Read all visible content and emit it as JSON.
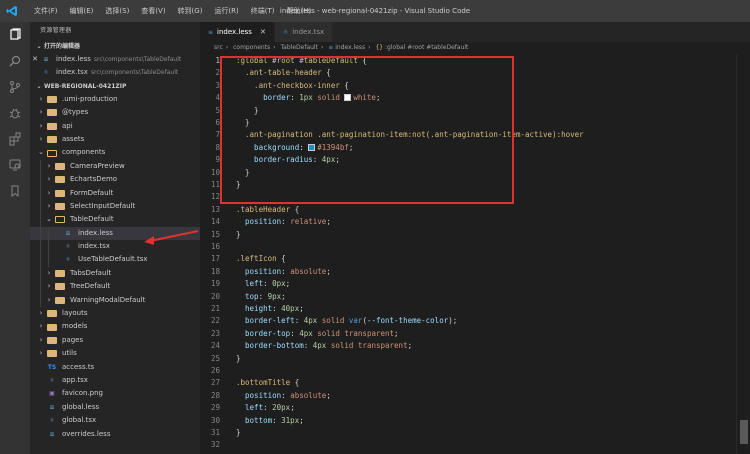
{
  "window": {
    "title": "index.less - web-regional-0421zip - Visual Studio Code",
    "menu": [
      "文件(F)",
      "编辑(E)",
      "选择(S)",
      "查看(V)",
      "转到(G)",
      "运行(R)",
      "终端(T)",
      "帮助(H)"
    ]
  },
  "activity_bar": {
    "icons": [
      "files-icon",
      "search-icon",
      "source-control-icon",
      "debug-icon",
      "extensions-icon",
      "remote-icon",
      "bookmark-icon"
    ]
  },
  "sidebar": {
    "header": "资源管理器",
    "open_editors_title": "打开的编辑器",
    "open_editors": [
      {
        "name": "index.less",
        "path": "src\\components\\TableDefault",
        "type": "less"
      },
      {
        "name": "index.tsx",
        "path": "src\\components\\TableDefault",
        "type": "tsx"
      }
    ],
    "project_title": "WEB-REGIONAL-0421ZIP",
    "tree": [
      {
        "label": ".umi-production",
        "kind": "folder",
        "depth": 1,
        "expanded": false
      },
      {
        "label": "@types",
        "kind": "folder",
        "depth": 1,
        "expanded": false
      },
      {
        "label": "api",
        "kind": "folder",
        "depth": 1,
        "expanded": false
      },
      {
        "label": "assets",
        "kind": "folder",
        "depth": 1,
        "expanded": false
      },
      {
        "label": "components",
        "kind": "folder",
        "depth": 1,
        "expanded": true
      },
      {
        "label": "CameraPreview",
        "kind": "folder",
        "depth": 2,
        "expanded": false
      },
      {
        "label": "EchartsDemo",
        "kind": "folder",
        "depth": 2,
        "expanded": false
      },
      {
        "label": "FormDefault",
        "kind": "folder",
        "depth": 2,
        "expanded": false
      },
      {
        "label": "SelectInputDefault",
        "kind": "folder",
        "depth": 2,
        "expanded": false
      },
      {
        "label": "TableDefault",
        "kind": "folder",
        "depth": 2,
        "expanded": true
      },
      {
        "label": "index.less",
        "kind": "less",
        "depth": 3,
        "selected": true
      },
      {
        "label": "index.tsx",
        "kind": "tsx",
        "depth": 3
      },
      {
        "label": "UseTableDefault.tsx",
        "kind": "tsx",
        "depth": 3
      },
      {
        "label": "TabsDefault",
        "kind": "folder",
        "depth": 2,
        "expanded": false
      },
      {
        "label": "TreeDefault",
        "kind": "folder",
        "depth": 2,
        "expanded": false
      },
      {
        "label": "WarningModalDefault",
        "kind": "folder",
        "depth": 2,
        "expanded": false
      },
      {
        "label": "layouts",
        "kind": "folder",
        "depth": 1,
        "expanded": false
      },
      {
        "label": "models",
        "kind": "folder",
        "depth": 1,
        "expanded": false
      },
      {
        "label": "pages",
        "kind": "folder",
        "depth": 1,
        "expanded": false
      },
      {
        "label": "utils",
        "kind": "folder",
        "depth": 1,
        "expanded": false
      },
      {
        "label": "access.ts",
        "kind": "ts",
        "depth": 1
      },
      {
        "label": "app.tsx",
        "kind": "tsx",
        "depth": 1
      },
      {
        "label": "favicon.png",
        "kind": "png",
        "depth": 1
      },
      {
        "label": "global.less",
        "kind": "less",
        "depth": 1
      },
      {
        "label": "global.tsx",
        "kind": "tsx",
        "depth": 1
      },
      {
        "label": "overrides.less",
        "kind": "less",
        "depth": 1
      }
    ]
  },
  "tabs": [
    {
      "label": "index.less",
      "active": true
    },
    {
      "label": "index.tsx",
      "active": false
    }
  ],
  "breadcrumb": [
    "src",
    "components",
    "TableDefault",
    "index.less",
    ":global #root #tableDefault"
  ],
  "code_lines": [
    {
      "n": "1",
      "tokens": [
        [
          "k-sel",
          ":global #root #tableDefault"
        ],
        [
          "k-punc",
          " {"
        ]
      ]
    },
    {
      "n": "2",
      "tokens": [
        [
          "k-sel",
          "  .ant-table-header"
        ],
        [
          "k-punc",
          " {"
        ]
      ]
    },
    {
      "n": "3",
      "tokens": [
        [
          "k-sel",
          "    .ant-checkbox-inner"
        ],
        [
          "k-punc",
          " {"
        ]
      ]
    },
    {
      "n": "4",
      "tokens": [
        [
          "k-prop",
          "      border"
        ],
        [
          "k-punc",
          ": "
        ],
        [
          "k-num",
          "1px"
        ],
        [
          "k-val",
          " solid "
        ],
        [
          "swatch",
          "#ffffff"
        ],
        [
          "k-val",
          "white"
        ],
        [
          "k-punc",
          ";"
        ]
      ]
    },
    {
      "n": "5",
      "tokens": [
        [
          "k-punc",
          "    }"
        ]
      ]
    },
    {
      "n": "6",
      "tokens": [
        [
          "k-punc",
          "  }"
        ]
      ]
    },
    {
      "n": "7",
      "tokens": [
        [
          "k-sel",
          "  .ant-pagination .ant-pagination-item:not(.ant-pagination-item-active):hover"
        ]
      ]
    },
    {
      "n": "8",
      "tokens": [
        [
          "k-prop",
          "    background"
        ],
        [
          "k-punc",
          ": "
        ],
        [
          "swatch",
          "#1394bf"
        ],
        [
          "k-val",
          "#1394bf"
        ],
        [
          "k-punc",
          ";"
        ]
      ]
    },
    {
      "n": "9",
      "tokens": [
        [
          "k-prop",
          "    border-radius"
        ],
        [
          "k-punc",
          ": "
        ],
        [
          "k-num",
          "4px"
        ],
        [
          "k-punc",
          ";"
        ]
      ]
    },
    {
      "n": "10",
      "tokens": [
        [
          "k-punc",
          "  }"
        ]
      ]
    },
    {
      "n": "11",
      "tokens": [
        [
          "k-punc",
          "}"
        ]
      ]
    },
    {
      "n": "12",
      "tokens": []
    },
    {
      "n": "13",
      "tokens": [
        [
          "k-sel",
          ".tableHeader"
        ],
        [
          "k-punc",
          " {"
        ]
      ]
    },
    {
      "n": "14",
      "tokens": [
        [
          "k-prop",
          "  position"
        ],
        [
          "k-punc",
          ": "
        ],
        [
          "k-val",
          "relative"
        ],
        [
          "k-punc",
          ";"
        ]
      ]
    },
    {
      "n": "15",
      "tokens": [
        [
          "k-punc",
          "}"
        ]
      ]
    },
    {
      "n": "16",
      "tokens": []
    },
    {
      "n": "17",
      "tokens": [
        [
          "k-sel",
          ".leftIcon"
        ],
        [
          "k-punc",
          " {"
        ]
      ]
    },
    {
      "n": "18",
      "tokens": [
        [
          "k-prop",
          "  position"
        ],
        [
          "k-punc",
          ": "
        ],
        [
          "k-val",
          "absolute"
        ],
        [
          "k-punc",
          ";"
        ]
      ]
    },
    {
      "n": "19",
      "tokens": [
        [
          "k-prop",
          "  left"
        ],
        [
          "k-punc",
          ": "
        ],
        [
          "k-num",
          "0px"
        ],
        [
          "k-punc",
          ";"
        ]
      ]
    },
    {
      "n": "20",
      "tokens": [
        [
          "k-prop",
          "  top"
        ],
        [
          "k-punc",
          ": "
        ],
        [
          "k-num",
          "9px"
        ],
        [
          "k-punc",
          ";"
        ]
      ]
    },
    {
      "n": "21",
      "tokens": [
        [
          "k-prop",
          "  height"
        ],
        [
          "k-punc",
          ": "
        ],
        [
          "k-num",
          "40px"
        ],
        [
          "k-punc",
          ";"
        ]
      ]
    },
    {
      "n": "22",
      "tokens": [
        [
          "k-prop",
          "  border-left"
        ],
        [
          "k-punc",
          ": "
        ],
        [
          "k-num",
          "4px"
        ],
        [
          "k-val",
          " solid "
        ],
        [
          "k-kw",
          "var"
        ],
        [
          "k-punc",
          "("
        ],
        [
          "k-prop",
          "--font-theme-color"
        ],
        [
          "k-punc",
          ");"
        ]
      ]
    },
    {
      "n": "23",
      "tokens": [
        [
          "k-prop",
          "  border-top"
        ],
        [
          "k-punc",
          ": "
        ],
        [
          "k-num",
          "4px"
        ],
        [
          "k-val",
          " solid transparent"
        ],
        [
          "k-punc",
          ";"
        ]
      ]
    },
    {
      "n": "24",
      "tokens": [
        [
          "k-prop",
          "  border-bottom"
        ],
        [
          "k-punc",
          ": "
        ],
        [
          "k-num",
          "4px"
        ],
        [
          "k-val",
          " solid transparent"
        ],
        [
          "k-punc",
          ";"
        ]
      ]
    },
    {
      "n": "25",
      "tokens": [
        [
          "k-punc",
          "}"
        ]
      ]
    },
    {
      "n": "26",
      "tokens": []
    },
    {
      "n": "27",
      "tokens": [
        [
          "k-sel",
          ".bottomTitle"
        ],
        [
          "k-punc",
          " {"
        ]
      ]
    },
    {
      "n": "28",
      "tokens": [
        [
          "k-prop",
          "  position"
        ],
        [
          "k-punc",
          ": "
        ],
        [
          "k-val",
          "absolute"
        ],
        [
          "k-punc",
          ";"
        ]
      ]
    },
    {
      "n": "29",
      "tokens": [
        [
          "k-prop",
          "  left"
        ],
        [
          "k-punc",
          ": "
        ],
        [
          "k-num",
          "20px"
        ],
        [
          "k-punc",
          ";"
        ]
      ]
    },
    {
      "n": "30",
      "tokens": [
        [
          "k-prop",
          "  bottom"
        ],
        [
          "k-punc",
          ": "
        ],
        [
          "k-num",
          "31px"
        ],
        [
          "k-punc",
          ";"
        ]
      ]
    },
    {
      "n": "31",
      "tokens": [
        [
          "k-punc",
          "}"
        ]
      ]
    },
    {
      "n": "32",
      "tokens": []
    }
  ],
  "colors": {
    "annotation_red": "#e03131",
    "accent": "#007acc"
  }
}
